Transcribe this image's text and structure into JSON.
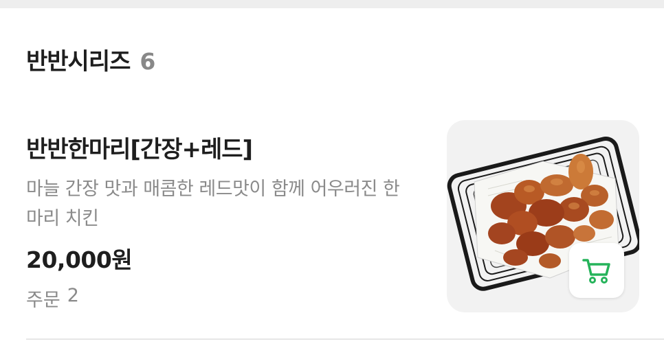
{
  "section": {
    "title": "반반시리즈",
    "count": "6"
  },
  "item": {
    "name": "반반한마리[간장+레드]",
    "description": "마늘 간장 맛과 매콤한 레드맛이 함께 어우러진 한 마리 치킨",
    "price": "20,000원",
    "orders_label": "주문",
    "orders_count": "2",
    "image_icon": "fried-chicken-basket-photo",
    "cart_icon": "shopping-cart-icon"
  },
  "colors": {
    "accent": "#25b35a",
    "title": "#1e1e1e",
    "muted": "#8a8a8a",
    "background": "#ffffff"
  }
}
